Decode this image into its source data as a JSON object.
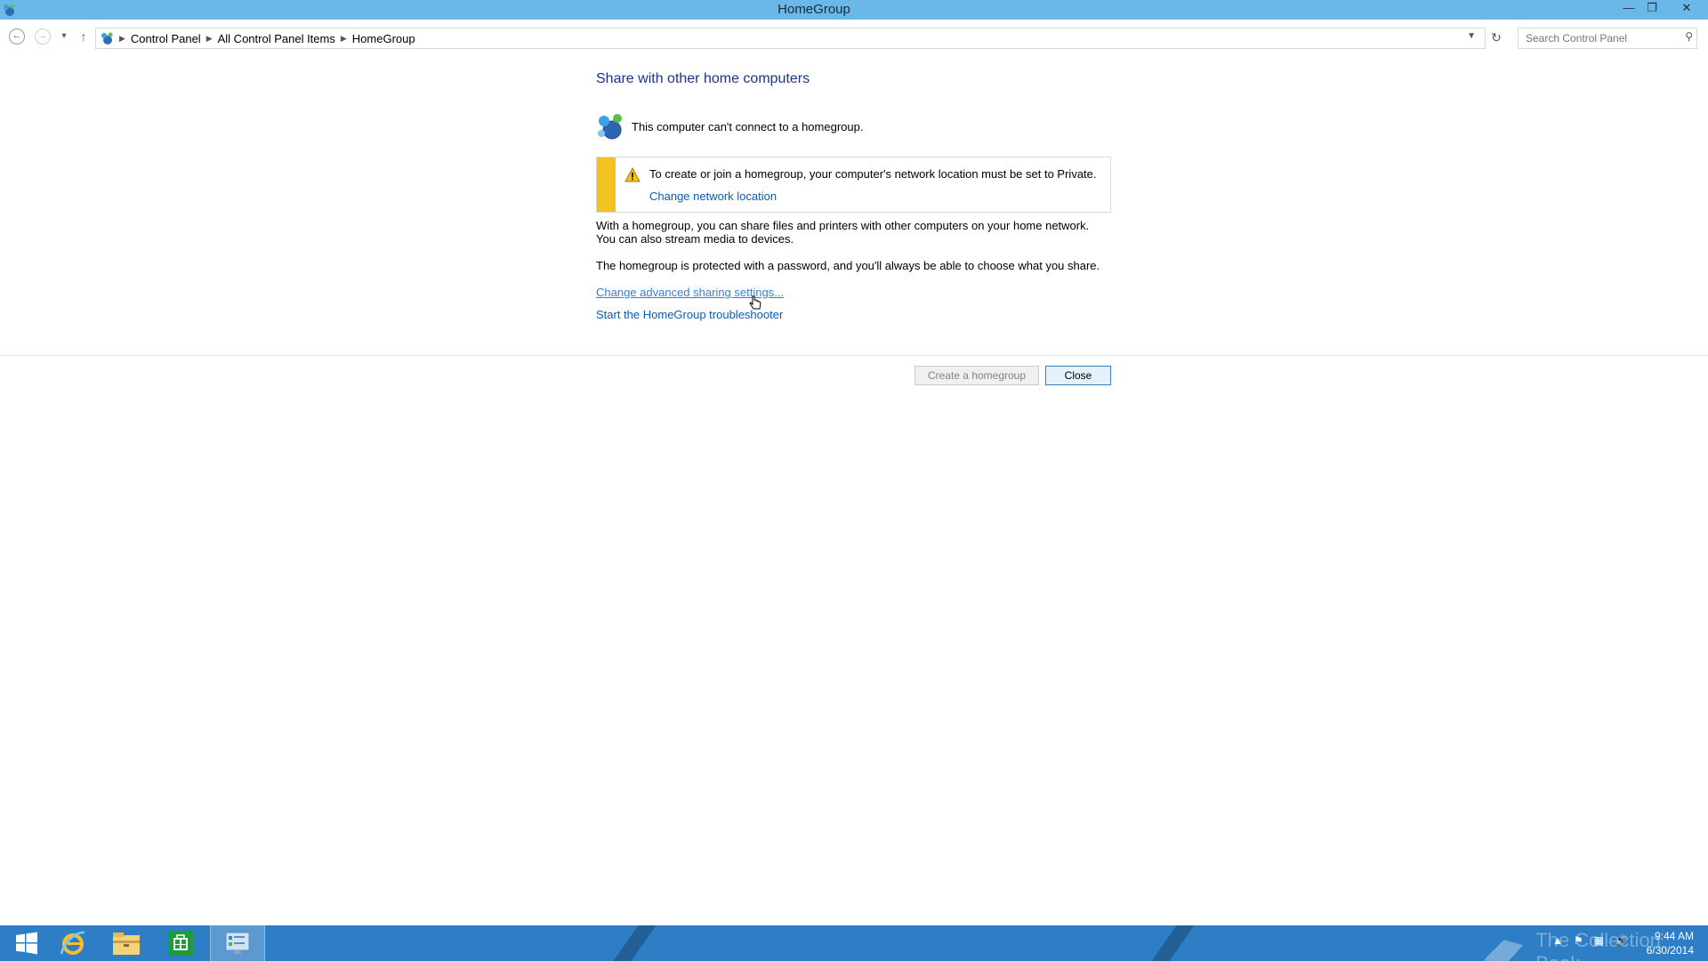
{
  "window": {
    "title": "HomeGroup",
    "minimize_glyph": "—",
    "restore_glyph": "❐",
    "close_glyph": "✕"
  },
  "nav": {
    "back_glyph": "←",
    "forward_glyph": "→",
    "recent_glyph": "▾",
    "up_glyph": "↑",
    "breadcrumbs": [
      "Control Panel",
      "All Control Panel Items",
      "HomeGroup"
    ],
    "search_placeholder": "Search Control Panel"
  },
  "main": {
    "heading": "Share with other home computers",
    "status": "This computer can't connect to a homegroup.",
    "warning": {
      "message": "To create or join a homegroup, your computer's network location must be set to Private.",
      "link": "Change network location"
    },
    "paragraph1": "With a homegroup, you can share files and printers with other computers on your home network. You can also stream media to devices.",
    "paragraph2": "The homegroup is protected with a password, and you'll always be able to choose what you share.",
    "link_advanced": "Change advanced sharing settings...",
    "link_troubleshooter": "Start the HomeGroup troubleshooter"
  },
  "buttons": {
    "create": "Create a homegroup",
    "close": "Close"
  },
  "taskbar": {
    "apps": [
      "start-icon",
      "internet-explorer-icon",
      "file-explorer-icon",
      "store-icon",
      "control-panel-icon"
    ],
    "watermark": "The Collection Book",
    "clock_time": "9:44 AM",
    "clock_date": "6/30/2014"
  },
  "colors": {
    "titlebar": "#6ab8e8",
    "taskbar": "#2d7ec4",
    "heading": "#1e3287",
    "link": "#0a5cb5",
    "warning_bar": "#f3c31d"
  }
}
